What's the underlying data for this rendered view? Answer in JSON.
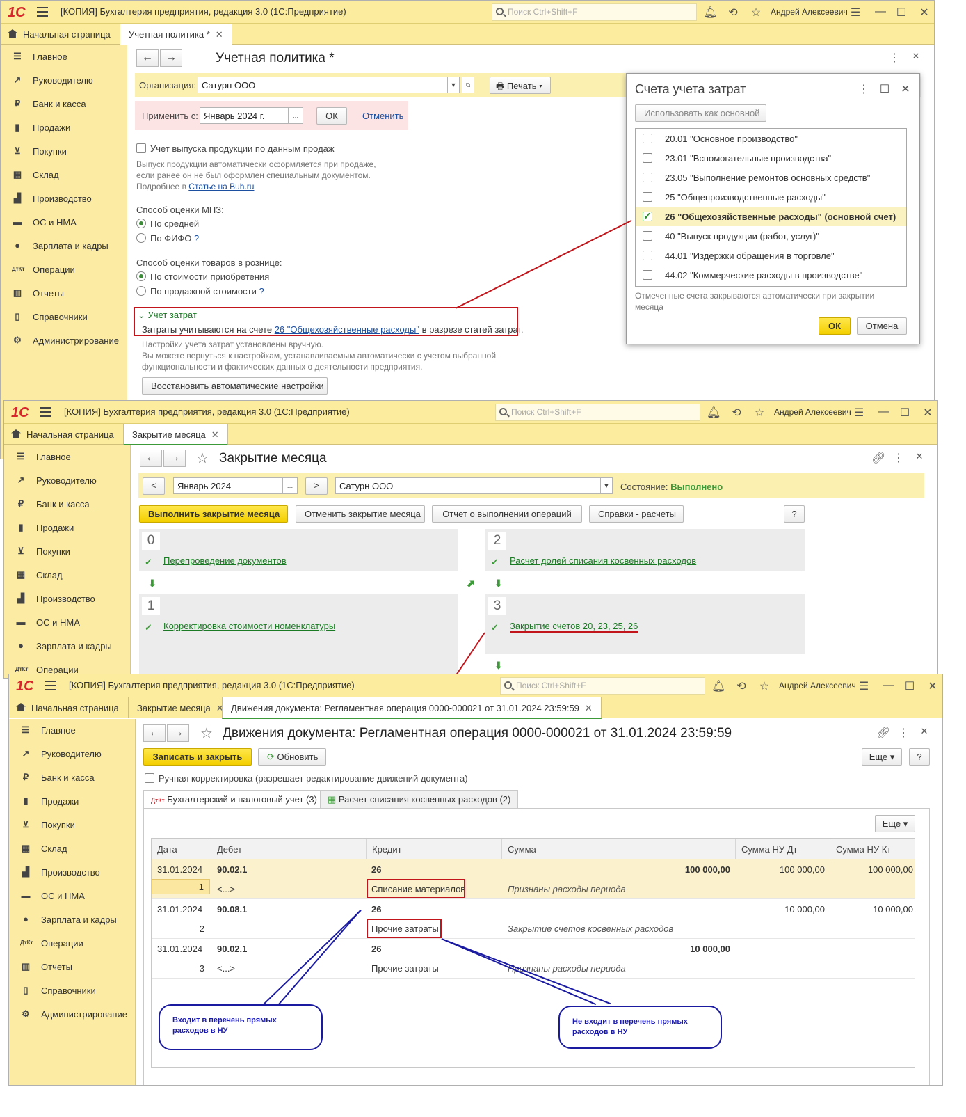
{
  "window1": {
    "title": "[КОПИЯ] Бухгалтерия предприятия, редакция 3.0  (1С:Предприятие)",
    "search_placeholder": "Поиск Ctrl+Shift+F",
    "user": "Андрей Алексеевич",
    "tabs": [
      {
        "label": "Начальная страница"
      },
      {
        "label": "Учетная политика *"
      }
    ],
    "sidebar": [
      "Главное",
      "Руководителю",
      "Банк и касса",
      "Продажи",
      "Покупки",
      "Склад",
      "Производство",
      "ОС и НМА",
      "Зарплата и кадры",
      "Операции",
      "Отчеты",
      "Справочники",
      "Администрирование"
    ],
    "form_title": "Учетная политика *",
    "org_label": "Организация:",
    "org_value": "Сатурн ООО",
    "print_button": "Печать",
    "apply_label": "Применить с:",
    "apply_value": "Январь 2024 г.",
    "ok_button": "ОК",
    "cancel_link": "Отменить",
    "sales_checkbox": "Учет выпуска продукции по данным продаж",
    "sales_note_1": "Выпуск продукции автоматически оформляется при продаже,",
    "sales_note_2": "если ранее он не был оформлен специальным документом.",
    "more_prefix": "Подробнее в",
    "more_link": "Статье на Buh.ru",
    "mpz_label": "Способ оценки МПЗ:",
    "mpz_option_1": "По средней",
    "mpz_option_2": "По ФИФО",
    "retail_label": "Способ оценки товаров в рознице:",
    "retail_option_1": "По стоимости приобретения",
    "retail_option_2": "По продажной стоимости",
    "help_mark": "?",
    "costs_section": "Учет затрат",
    "costs_prefix": "Затраты учитываются на счете",
    "costs_link": "26 \"Общехозяйственные расходы\"",
    "costs_suffix": "в разрезе статей затрат.",
    "manual_note_1": "Настройки учета затрат установлены вручную.",
    "manual_note_2": "Вы можете вернуться к настройкам, устанавливаемым автоматически с учетом выбранной",
    "manual_note_3": "функциональности и фактических данных о деятельности предприятия.",
    "restore_button": "Восстановить автоматические настройки"
  },
  "popup": {
    "title": "Счета учета затрат",
    "use_main_button": "Использовать как основной",
    "accounts": [
      {
        "label": "20.01 \"Основное производство\"",
        "checked": false
      },
      {
        "label": "23.01 \"Вспомогательные производства\"",
        "checked": false
      },
      {
        "label": "23.05 \"Выполнение ремонтов основных средств\"",
        "checked": false
      },
      {
        "label": "25 \"Общепроизводственные расходы\"",
        "checked": false
      },
      {
        "label": "26 \"Общехозяйственные расходы\" (основной счет)",
        "checked": true
      },
      {
        "label": "40 \"Выпуск продукции (работ, услуг)\"",
        "checked": false
      },
      {
        "label": "44.01 \"Издержки обращения в торговле\"",
        "checked": false
      },
      {
        "label": "44.02 \"Коммерческие расходы в производстве\"",
        "checked": false
      }
    ],
    "note_1": "Отмеченные счета закрываются автоматически при закрытии",
    "note_2": "месяца",
    "ok_button": "ОК",
    "cancel_button": "Отмена"
  },
  "window2": {
    "title": "[КОПИЯ] Бухгалтерия предприятия, редакция 3.0  (1С:Предприятие)",
    "search_placeholder": "Поиск Ctrl+Shift+F",
    "user": "Андрей Алексеевич",
    "tabs": [
      {
        "label": "Начальная страница"
      },
      {
        "label": "Закрытие месяца"
      }
    ],
    "form_title": "Закрытие месяца",
    "period_value": "Январь 2024",
    "org_value": "Сатурн ООО",
    "state_label": "Состояние:",
    "state_value": "Выполнено",
    "run_button": "Выполнить закрытие месяца",
    "undo_button": "Отменить закрытие месяца",
    "report_button": "Отчет о выполнении операций",
    "calc_button": "Справки - расчеты",
    "help_button": "?",
    "steps": [
      {
        "num": "0",
        "link": "Перепроведение документов"
      },
      {
        "num": "1",
        "link": "Корректировка стоимости номенклатуры"
      },
      {
        "num": "2",
        "link": "Расчет долей списания косвенных расходов"
      },
      {
        "num": "3",
        "link": "Закрытие счетов 20, 23, 25, 26"
      }
    ]
  },
  "window3": {
    "title": "[КОПИЯ] Бухгалтерия предприятия, редакция 3.0  (1С:Предприятие)",
    "search_placeholder": "Поиск Ctrl+Shift+F",
    "user": "Андрей Алексеевич",
    "tabs": [
      {
        "label": "Начальная страница"
      },
      {
        "label": "Закрытие месяца"
      },
      {
        "label": "Движения документа: Регламентная операция 0000-000021 от 31.01.2024 23:59:59"
      }
    ],
    "form_title": "Движения документа: Регламентная операция 0000-000021 от 31.01.2024 23:59:59",
    "save_button": "Записать и закрыть",
    "refresh_button": "Обновить",
    "more_button": "Еще",
    "help_button": "?",
    "manual_checkbox": "Ручная корректировка (разрешает редактирование движений документа)",
    "subtabs": [
      "Бухгалтерский и налоговый учет (3)",
      "Расчет списания косвенных расходов (2)"
    ],
    "columns": [
      "Дата",
      "Дебет",
      "Кредит",
      "Сумма",
      "Сумма НУ Дт",
      "Сумма НУ Кт"
    ],
    "rows": [
      {
        "date": "31.01.2024",
        "n": "1",
        "debit": "90.02.1",
        "debit_sub": "<...>",
        "credit": "26",
        "credit_sub": "Списание материалов",
        "sum": "100 000,00",
        "content": "Признаны расходы периода",
        "nu_dt": "100 000,00",
        "nu_kt": "100 000,00"
      },
      {
        "date": "31.01.2024",
        "n": "2",
        "debit": "90.08.1",
        "debit_sub": "",
        "credit": "26",
        "credit_sub": "Прочие затраты",
        "sum": "",
        "content": "Закрытие счетов косвенных расходов",
        "nu_dt": "10 000,00",
        "nu_kt": "10 000,00"
      },
      {
        "date": "31.01.2024",
        "n": "3",
        "debit": "90.02.1",
        "debit_sub": "<...>",
        "credit": "26",
        "credit_sub": "Прочие затраты",
        "sum": "10 000,00",
        "content": "Признаны расходы периода",
        "nu_dt": "",
        "nu_kt": ""
      }
    ],
    "callout_left": "Входит в перечень прямых расходов в НУ",
    "callout_right": "Не входит в перечень прямых расходов в НУ"
  },
  "colors": {
    "accent_yellow": "#fbec9e",
    "link_green": "#1a7a23",
    "red_frame": "#c2151b",
    "callout_blue": "#1a1aa0"
  }
}
